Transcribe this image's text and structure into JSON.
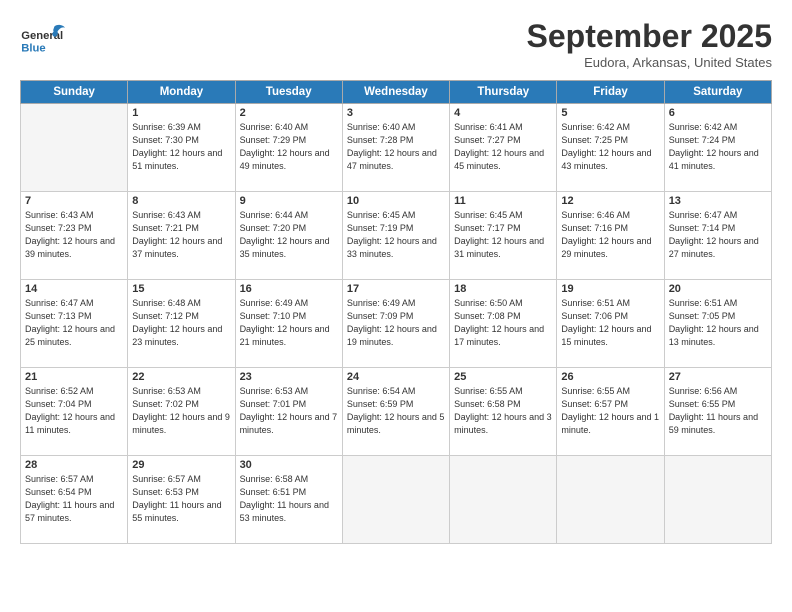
{
  "header": {
    "logo_line1": "General",
    "logo_line2": "Blue",
    "month": "September 2025",
    "location": "Eudora, Arkansas, United States"
  },
  "days_of_week": [
    "Sunday",
    "Monday",
    "Tuesday",
    "Wednesday",
    "Thursday",
    "Friday",
    "Saturday"
  ],
  "weeks": [
    [
      {
        "day": "",
        "empty": true
      },
      {
        "day": "1",
        "sunrise": "Sunrise: 6:39 AM",
        "sunset": "Sunset: 7:30 PM",
        "daylight": "Daylight: 12 hours and 51 minutes."
      },
      {
        "day": "2",
        "sunrise": "Sunrise: 6:40 AM",
        "sunset": "Sunset: 7:29 PM",
        "daylight": "Daylight: 12 hours and 49 minutes."
      },
      {
        "day": "3",
        "sunrise": "Sunrise: 6:40 AM",
        "sunset": "Sunset: 7:28 PM",
        "daylight": "Daylight: 12 hours and 47 minutes."
      },
      {
        "day": "4",
        "sunrise": "Sunrise: 6:41 AM",
        "sunset": "Sunset: 7:27 PM",
        "daylight": "Daylight: 12 hours and 45 minutes."
      },
      {
        "day": "5",
        "sunrise": "Sunrise: 6:42 AM",
        "sunset": "Sunset: 7:25 PM",
        "daylight": "Daylight: 12 hours and 43 minutes."
      },
      {
        "day": "6",
        "sunrise": "Sunrise: 6:42 AM",
        "sunset": "Sunset: 7:24 PM",
        "daylight": "Daylight: 12 hours and 41 minutes."
      }
    ],
    [
      {
        "day": "7",
        "sunrise": "Sunrise: 6:43 AM",
        "sunset": "Sunset: 7:23 PM",
        "daylight": "Daylight: 12 hours and 39 minutes."
      },
      {
        "day": "8",
        "sunrise": "Sunrise: 6:43 AM",
        "sunset": "Sunset: 7:21 PM",
        "daylight": "Daylight: 12 hours and 37 minutes."
      },
      {
        "day": "9",
        "sunrise": "Sunrise: 6:44 AM",
        "sunset": "Sunset: 7:20 PM",
        "daylight": "Daylight: 12 hours and 35 minutes."
      },
      {
        "day": "10",
        "sunrise": "Sunrise: 6:45 AM",
        "sunset": "Sunset: 7:19 PM",
        "daylight": "Daylight: 12 hours and 33 minutes."
      },
      {
        "day": "11",
        "sunrise": "Sunrise: 6:45 AM",
        "sunset": "Sunset: 7:17 PM",
        "daylight": "Daylight: 12 hours and 31 minutes."
      },
      {
        "day": "12",
        "sunrise": "Sunrise: 6:46 AM",
        "sunset": "Sunset: 7:16 PM",
        "daylight": "Daylight: 12 hours and 29 minutes."
      },
      {
        "day": "13",
        "sunrise": "Sunrise: 6:47 AM",
        "sunset": "Sunset: 7:14 PM",
        "daylight": "Daylight: 12 hours and 27 minutes."
      }
    ],
    [
      {
        "day": "14",
        "sunrise": "Sunrise: 6:47 AM",
        "sunset": "Sunset: 7:13 PM",
        "daylight": "Daylight: 12 hours and 25 minutes."
      },
      {
        "day": "15",
        "sunrise": "Sunrise: 6:48 AM",
        "sunset": "Sunset: 7:12 PM",
        "daylight": "Daylight: 12 hours and 23 minutes."
      },
      {
        "day": "16",
        "sunrise": "Sunrise: 6:49 AM",
        "sunset": "Sunset: 7:10 PM",
        "daylight": "Daylight: 12 hours and 21 minutes."
      },
      {
        "day": "17",
        "sunrise": "Sunrise: 6:49 AM",
        "sunset": "Sunset: 7:09 PM",
        "daylight": "Daylight: 12 hours and 19 minutes."
      },
      {
        "day": "18",
        "sunrise": "Sunrise: 6:50 AM",
        "sunset": "Sunset: 7:08 PM",
        "daylight": "Daylight: 12 hours and 17 minutes."
      },
      {
        "day": "19",
        "sunrise": "Sunrise: 6:51 AM",
        "sunset": "Sunset: 7:06 PM",
        "daylight": "Daylight: 12 hours and 15 minutes."
      },
      {
        "day": "20",
        "sunrise": "Sunrise: 6:51 AM",
        "sunset": "Sunset: 7:05 PM",
        "daylight": "Daylight: 12 hours and 13 minutes."
      }
    ],
    [
      {
        "day": "21",
        "sunrise": "Sunrise: 6:52 AM",
        "sunset": "Sunset: 7:04 PM",
        "daylight": "Daylight: 12 hours and 11 minutes."
      },
      {
        "day": "22",
        "sunrise": "Sunrise: 6:53 AM",
        "sunset": "Sunset: 7:02 PM",
        "daylight": "Daylight: 12 hours and 9 minutes."
      },
      {
        "day": "23",
        "sunrise": "Sunrise: 6:53 AM",
        "sunset": "Sunset: 7:01 PM",
        "daylight": "Daylight: 12 hours and 7 minutes."
      },
      {
        "day": "24",
        "sunrise": "Sunrise: 6:54 AM",
        "sunset": "Sunset: 6:59 PM",
        "daylight": "Daylight: 12 hours and 5 minutes."
      },
      {
        "day": "25",
        "sunrise": "Sunrise: 6:55 AM",
        "sunset": "Sunset: 6:58 PM",
        "daylight": "Daylight: 12 hours and 3 minutes."
      },
      {
        "day": "26",
        "sunrise": "Sunrise: 6:55 AM",
        "sunset": "Sunset: 6:57 PM",
        "daylight": "Daylight: 12 hours and 1 minute."
      },
      {
        "day": "27",
        "sunrise": "Sunrise: 6:56 AM",
        "sunset": "Sunset: 6:55 PM",
        "daylight": "Daylight: 11 hours and 59 minutes."
      }
    ],
    [
      {
        "day": "28",
        "sunrise": "Sunrise: 6:57 AM",
        "sunset": "Sunset: 6:54 PM",
        "daylight": "Daylight: 11 hours and 57 minutes."
      },
      {
        "day": "29",
        "sunrise": "Sunrise: 6:57 AM",
        "sunset": "Sunset: 6:53 PM",
        "daylight": "Daylight: 11 hours and 55 minutes."
      },
      {
        "day": "30",
        "sunrise": "Sunrise: 6:58 AM",
        "sunset": "Sunset: 6:51 PM",
        "daylight": "Daylight: 11 hours and 53 minutes."
      },
      {
        "day": "",
        "empty": true
      },
      {
        "day": "",
        "empty": true
      },
      {
        "day": "",
        "empty": true
      },
      {
        "day": "",
        "empty": true
      }
    ]
  ]
}
